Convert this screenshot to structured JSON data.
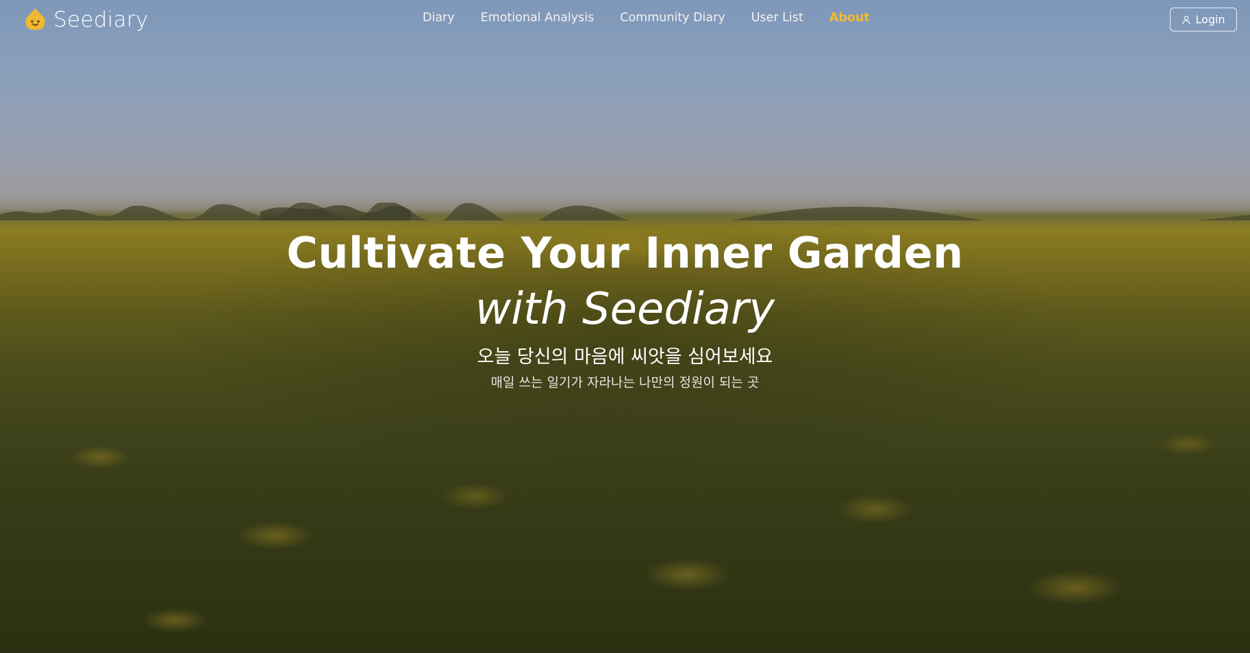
{
  "brand": {
    "name": "Seediary",
    "logo_icon": "seed-face-icon",
    "accent_color": "#f2bb2c"
  },
  "nav": {
    "items": [
      {
        "label": "Diary",
        "active": false
      },
      {
        "label": "Emotional Analysis",
        "active": false
      },
      {
        "label": "Community Diary",
        "active": false
      },
      {
        "label": "User List",
        "active": false
      },
      {
        "label": "About",
        "active": true
      }
    ]
  },
  "auth": {
    "login_label": "Login",
    "login_icon": "user-icon"
  },
  "hero": {
    "title": "Cultivate Your Inner Garden",
    "subtitle": "with Seediary",
    "tagline": "오늘 당신의 마음에 씨앗을 심어보세요",
    "description": "매일 쓰는 일기가 자라나는 나만의 정원이 되는 곳"
  }
}
